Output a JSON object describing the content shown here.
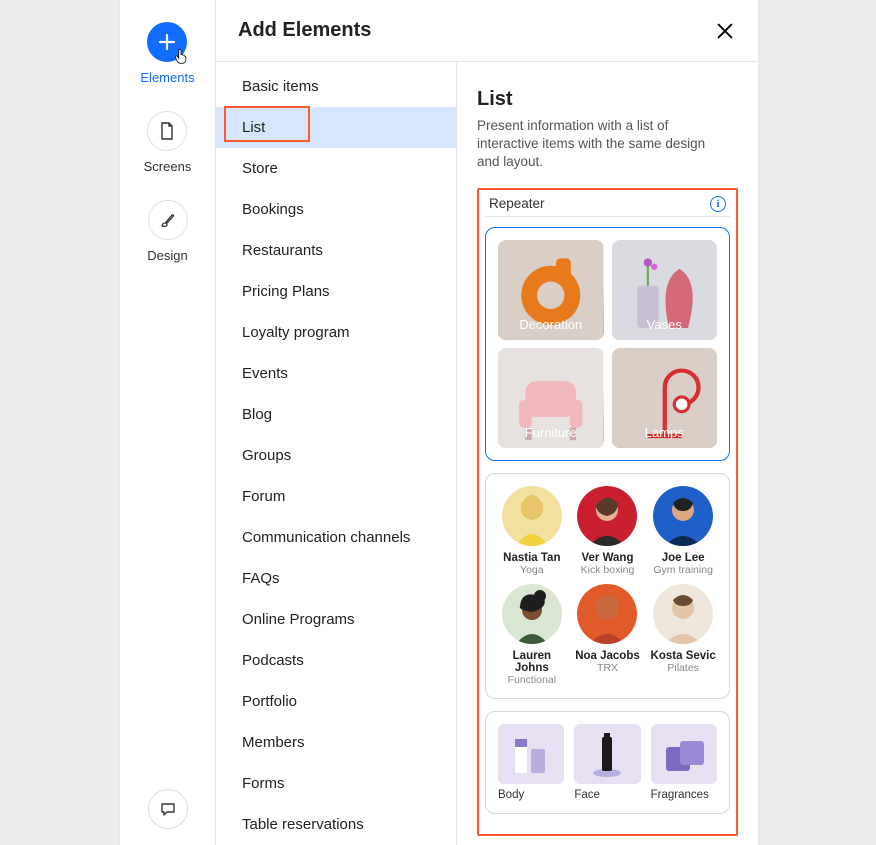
{
  "rail": {
    "items": [
      {
        "label": "Elements",
        "icon": "plus"
      },
      {
        "label": "Screens",
        "icon": "page"
      },
      {
        "label": "Design",
        "icon": "paintbrush"
      }
    ],
    "chat_icon": "chat"
  },
  "panel": {
    "title": "Add Elements"
  },
  "categories": [
    "Basic items",
    "List",
    "Store",
    "Bookings",
    "Restaurants",
    "Pricing Plans",
    "Loyalty program",
    "Events",
    "Blog",
    "Groups",
    "Forum",
    "Communication channels",
    "FAQs",
    "Online Programs",
    "Podcasts",
    "Portfolio",
    "Members",
    "Forms",
    "Table reservations"
  ],
  "selected_category_index": 1,
  "detail": {
    "title": "List",
    "description": "Present information with a list of interactive items with the same design and layout.",
    "section_label": "Repeater"
  },
  "repeater_previews": {
    "tiles": [
      {
        "label": "Decoration"
      },
      {
        "label": "Vases"
      },
      {
        "label": "Furniture"
      },
      {
        "label": "Lamps"
      }
    ],
    "people": [
      {
        "name": "Nastia Tan",
        "role": "Yoga"
      },
      {
        "name": "Ver Wang",
        "role": "Kick boxing"
      },
      {
        "name": "Joe Lee",
        "role": "Gym training"
      },
      {
        "name": "Lauren Johns",
        "role": "Functional"
      },
      {
        "name": "Noa Jacobs",
        "role": "TRX"
      },
      {
        "name": "Kosta Sevic",
        "role": "Pilates"
      }
    ],
    "products": [
      {
        "label": "Body"
      },
      {
        "label": "Face"
      },
      {
        "label": "Fragrances"
      }
    ]
  },
  "colors": {
    "accent": "#116dff",
    "highlight": "#ff5a2b"
  }
}
